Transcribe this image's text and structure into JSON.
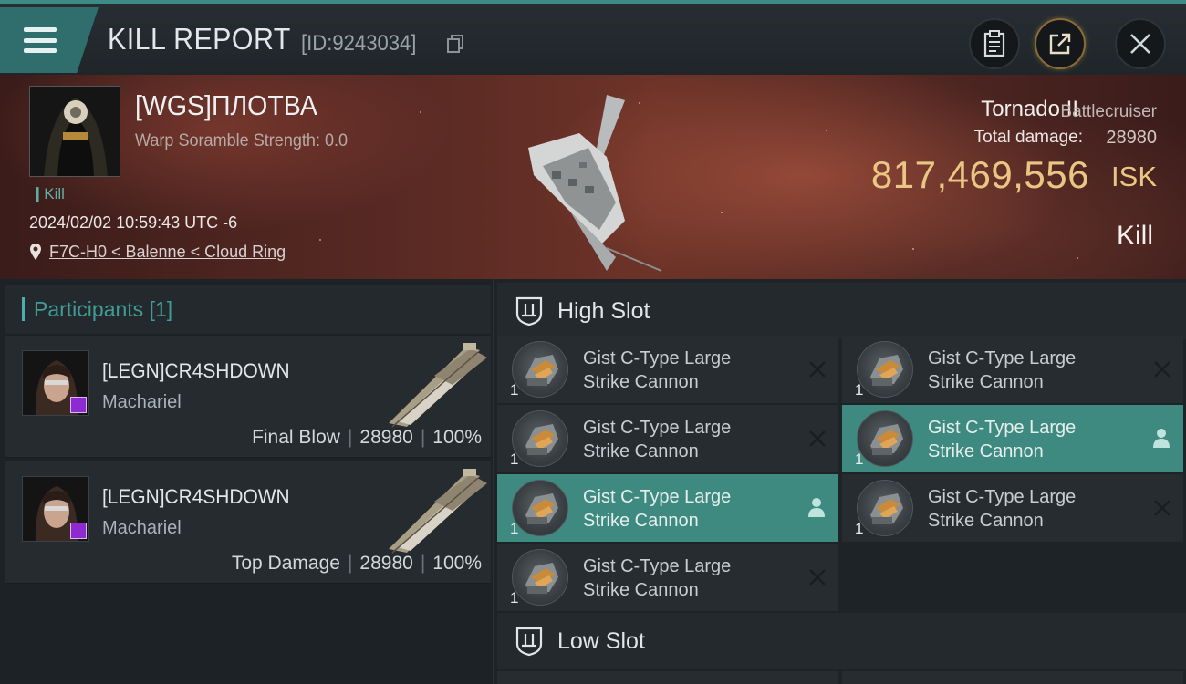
{
  "header": {
    "title": "KILL REPORT",
    "report_id": "[ID:9243034]"
  },
  "victim": {
    "pilot_name": "[WGS]ПЛОТВА",
    "scramble": "Warp Soramble Strength: 0.0",
    "kill_tag": "Kill",
    "timestamp": "2024/02/02 10:59:43 UTC -6",
    "location": "F7C-H0 < Balenne < Cloud Ring",
    "ship_name": "Tornado II",
    "ship_class": "Battlecruiser",
    "total_damage_label": "Total damage:",
    "total_damage": "28980",
    "isk_value": "817,469,556",
    "isk_unit": "ISK",
    "result": "Kill"
  },
  "participants": {
    "title": "Participants",
    "count": "[1]",
    "rows": [
      {
        "name": "[LEGN]CR4SHDOWN",
        "ship": "Machariel",
        "role": "Final Blow",
        "damage": "28980",
        "percent": "100%"
      },
      {
        "name": "[LEGN]CR4SHDOWN",
        "ship": "Machariel",
        "role": "Top Damage",
        "damage": "28980",
        "percent": "100%"
      }
    ],
    "separator": "|"
  },
  "fitting": {
    "high_slot_label": "High Slot",
    "low_slot_label": "Low Slot",
    "modules": [
      {
        "line1": "Gist C-Type Large",
        "line2": "Strike Cannon",
        "qty": "1",
        "state": "destroyed"
      },
      {
        "line1": "Gist C-Type Large",
        "line2": "Strike Cannon",
        "qty": "1",
        "state": "destroyed"
      },
      {
        "line1": "Gist C-Type Large",
        "line2": "Strike Cannon",
        "qty": "1",
        "state": "dropped"
      },
      {
        "line1": "Gist C-Type Large",
        "line2": "Strike Cannon",
        "qty": "1",
        "state": "destroyed"
      },
      {
        "line1": "Gist C-Type Large",
        "line2": "Strike Cannon",
        "qty": "1",
        "state": "destroyed"
      },
      {
        "line1": "Gist C-Type Large",
        "line2": "Strike Cannon",
        "qty": "1",
        "state": "dropped"
      },
      {
        "line1": "Gist C-Type Large",
        "line2": "Strike Cannon",
        "qty": "1",
        "state": "destroyed"
      }
    ]
  },
  "colors": {
    "accent": "#3f8a80",
    "isk_gold": "#eac684",
    "kill_green": "#5fb0a3",
    "badge_purple": "#8d2bd1"
  },
  "icons": {
    "menu": "menu-icon",
    "copy": "copy-icon",
    "clipboard": "clipboard-icon",
    "share": "share-icon",
    "close": "close-icon",
    "location": "location-pin-icon",
    "slot": "slot-shield-icon",
    "destroyed": "x-icon",
    "dropped": "person-icon"
  }
}
